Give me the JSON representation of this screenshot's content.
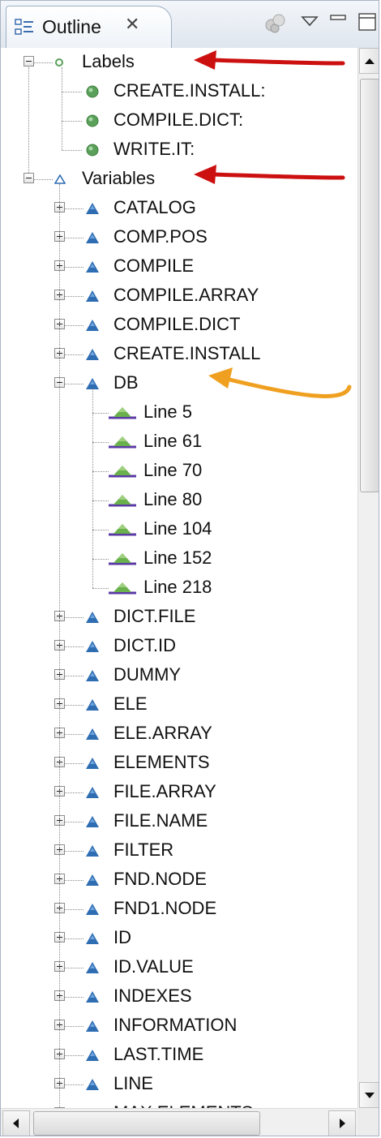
{
  "view": {
    "title": "Outline",
    "close_glyph": "✕"
  },
  "colors": {
    "label_node": "#5aa05a",
    "variable_node": "#2f6db3",
    "line_node": "#5b3aa6",
    "red_arrow": "#cc1010",
    "orange_arrow": "#f0a020"
  },
  "tree": {
    "labels_group": {
      "label": "Labels",
      "expanded": true,
      "children": [
        "CREATE.INSTALL:",
        "COMPILE.DICT:",
        "WRITE.IT:"
      ]
    },
    "variables_group": {
      "label": "Variables",
      "expanded": true,
      "children_before": [
        "CATALOG",
        "COMP.POS",
        "COMPILE",
        "COMPILE.ARRAY",
        "COMPILE.DICT",
        "CREATE.INSTALL"
      ],
      "expanded_item": {
        "label": "DB",
        "lines": [
          "Line 5",
          "Line 61",
          "Line 70",
          "Line 80",
          "Line 104",
          "Line 152",
          "Line 218"
        ]
      },
      "children_after": [
        "DICT.FILE",
        "DICT.ID",
        "DUMMY",
        "ELE",
        "ELE.ARRAY",
        "ELEMENTS",
        "FILE.ARRAY",
        "FILE.NAME",
        "FILTER",
        "FND.NODE",
        "FND1.NODE",
        "ID",
        "ID.VALUE",
        "INDEXES",
        "INFORMATION",
        "LAST.TIME",
        "LINE",
        "MAX.ELEMENTS"
      ]
    }
  },
  "icons": {
    "tab": "outline-view-icon",
    "toolbar": [
      "filter-icon",
      "view-menu-icon",
      "minimize-icon",
      "maximize-icon"
    ]
  }
}
